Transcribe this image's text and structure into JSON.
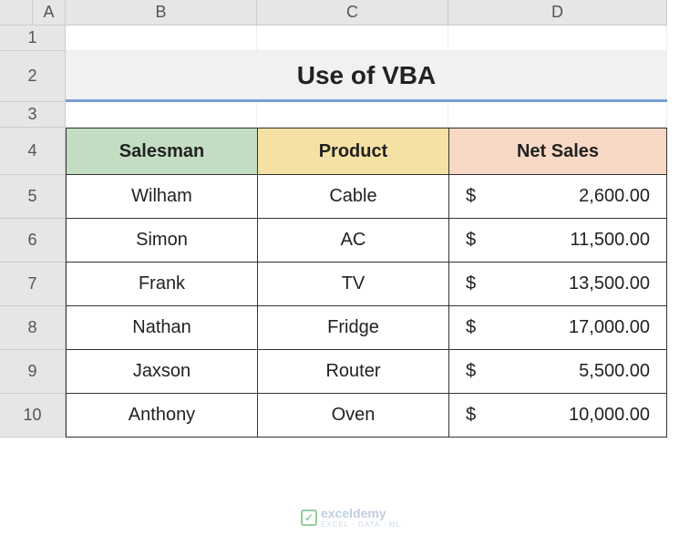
{
  "columns": {
    "A": "A",
    "B": "B",
    "C": "C",
    "D": "D"
  },
  "rows": {
    "r1": "1",
    "r2": "2",
    "r3": "3",
    "r4": "4",
    "r5": "5",
    "r6": "6",
    "r7": "7",
    "r8": "8",
    "r9": "9",
    "r10": "10"
  },
  "title": "Use of VBA",
  "headers": {
    "salesman": "Salesman",
    "product": "Product",
    "netsales": "Net Sales"
  },
  "currency": "$",
  "table": [
    {
      "salesman": "Wilham",
      "product": "Cable",
      "netsales": "2,600.00"
    },
    {
      "salesman": "Simon",
      "product": "AC",
      "netsales": "11,500.00"
    },
    {
      "salesman": "Frank",
      "product": "TV",
      "netsales": "13,500.00"
    },
    {
      "salesman": "Nathan",
      "product": "Fridge",
      "netsales": "17,000.00"
    },
    {
      "salesman": "Jaxson",
      "product": "Router",
      "netsales": "5,500.00"
    },
    {
      "salesman": "Anthony",
      "product": "Oven",
      "netsales": "10,000.00"
    }
  ],
  "watermark": {
    "brand": "exceldemy",
    "tagline": "EXCEL · DATA · ML"
  },
  "chart_data": {
    "type": "table",
    "title": "Use of VBA",
    "columns": [
      "Salesman",
      "Product",
      "Net Sales"
    ],
    "rows": [
      [
        "Wilham",
        "Cable",
        2600.0
      ],
      [
        "Simon",
        "AC",
        11500.0
      ],
      [
        "Frank",
        "TV",
        13500.0
      ],
      [
        "Nathan",
        "Fridge",
        17000.0
      ],
      [
        "Jaxson",
        "Router",
        5500.0
      ],
      [
        "Anthony",
        "Oven",
        10000.0
      ]
    ],
    "currency": "USD"
  }
}
